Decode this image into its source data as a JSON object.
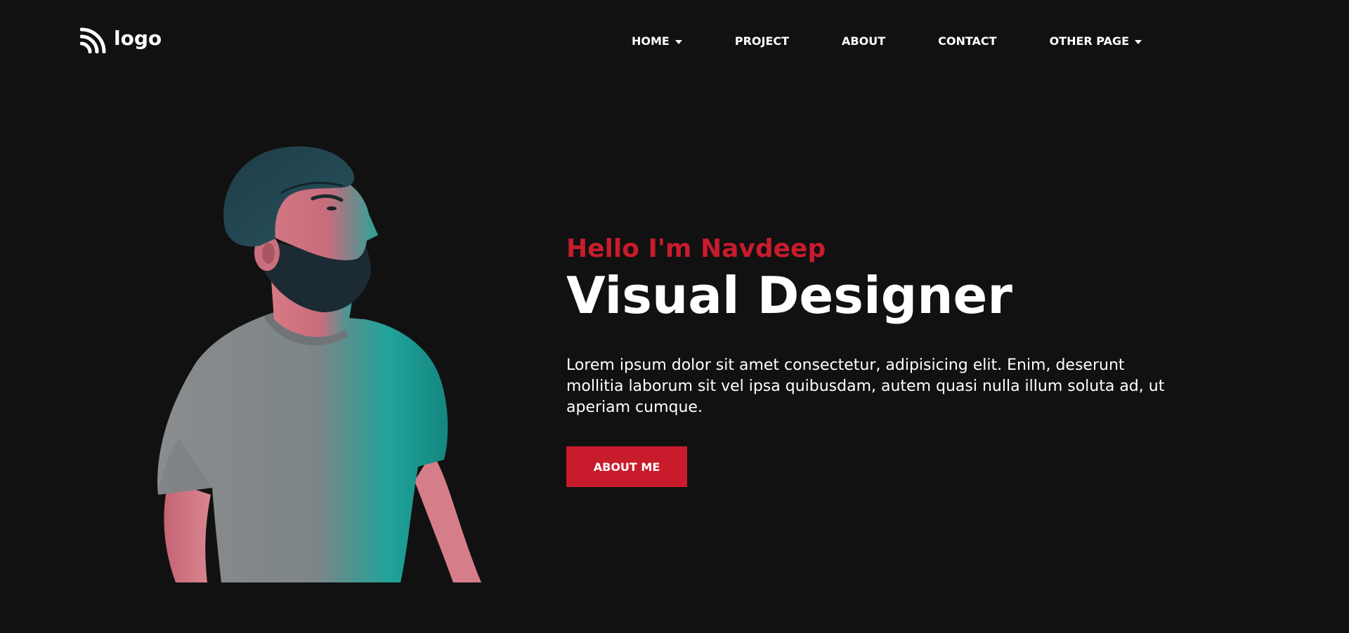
{
  "brand": {
    "logo_text": "logo",
    "logo_icon": "rss-wave-icon"
  },
  "nav": {
    "items": [
      {
        "label": "HOME",
        "has_dropdown": true
      },
      {
        "label": "PROJECT",
        "has_dropdown": false
      },
      {
        "label": "ABOUT",
        "has_dropdown": false
      },
      {
        "label": "CONTACT",
        "has_dropdown": false
      },
      {
        "label": "OTHER PAGE",
        "has_dropdown": true
      }
    ]
  },
  "hero": {
    "greeting": "Hello I'm Navdeep",
    "role": "Visual Designer",
    "bio": "Lorem ipsum dolor sit amet consectetur, adipisicing elit. Enim, deserunt mollitia laborum sit vel ipsa quibusdam, autem quasi nulla illum soluta ad, ut aperiam cumque.",
    "cta_label": "ABOUT ME"
  },
  "colors": {
    "background": "#111111",
    "accent": "#c81c2c",
    "text": "#ffffff"
  }
}
